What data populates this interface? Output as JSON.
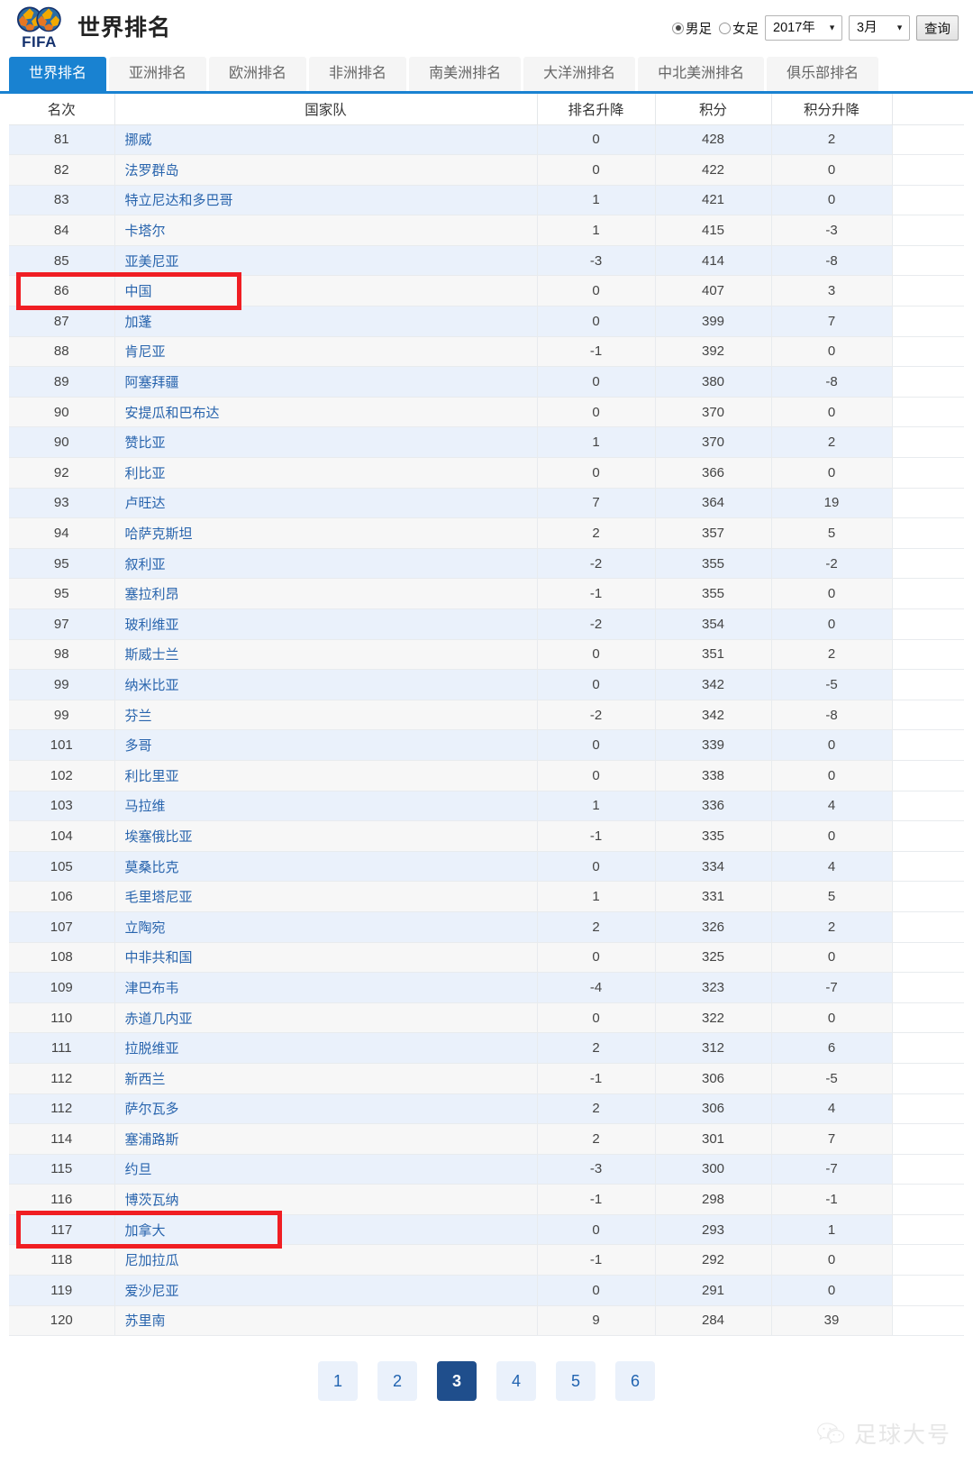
{
  "header": {
    "logo_alt": "FIFA",
    "title": "世界排名",
    "gender": {
      "male_label": "男足",
      "female_label": "女足",
      "selected": "男足"
    },
    "year_select": {
      "value": "2017年",
      "options": [
        "2017年"
      ]
    },
    "month_select": {
      "value": "3月",
      "options": [
        "3月"
      ]
    },
    "query_button": "查询"
  },
  "tabs": [
    {
      "label": "世界排名",
      "active": true
    },
    {
      "label": "亚洲排名",
      "active": false
    },
    {
      "label": "欧洲排名",
      "active": false
    },
    {
      "label": "非洲排名",
      "active": false
    },
    {
      "label": "南美洲排名",
      "active": false
    },
    {
      "label": "大洋洲排名",
      "active": false
    },
    {
      "label": "中北美洲排名",
      "active": false
    },
    {
      "label": "俱乐部排名",
      "active": false
    }
  ],
  "table": {
    "columns": [
      "名次",
      "国家队",
      "排名升降",
      "积分",
      "积分升降"
    ],
    "rows": [
      {
        "rank": "81",
        "country": "挪威",
        "delta": "0",
        "points": "428",
        "pts_delta": "2"
      },
      {
        "rank": "82",
        "country": "法罗群岛",
        "delta": "0",
        "points": "422",
        "pts_delta": "0"
      },
      {
        "rank": "83",
        "country": "特立尼达和多巴哥",
        "delta": "1",
        "points": "421",
        "pts_delta": "0"
      },
      {
        "rank": "84",
        "country": "卡塔尔",
        "delta": "1",
        "points": "415",
        "pts_delta": "-3"
      },
      {
        "rank": "85",
        "country": "亚美尼亚",
        "delta": "-3",
        "points": "414",
        "pts_delta": "-8"
      },
      {
        "rank": "86",
        "country": "中国",
        "delta": "0",
        "points": "407",
        "pts_delta": "3",
        "highlight": true
      },
      {
        "rank": "87",
        "country": "加蓬",
        "delta": "0",
        "points": "399",
        "pts_delta": "7"
      },
      {
        "rank": "88",
        "country": "肯尼亚",
        "delta": "-1",
        "points": "392",
        "pts_delta": "0"
      },
      {
        "rank": "89",
        "country": "阿塞拜疆",
        "delta": "0",
        "points": "380",
        "pts_delta": "-8"
      },
      {
        "rank": "90",
        "country": "安提瓜和巴布达",
        "delta": "0",
        "points": "370",
        "pts_delta": "0"
      },
      {
        "rank": "90",
        "country": "赞比亚",
        "delta": "1",
        "points": "370",
        "pts_delta": "2"
      },
      {
        "rank": "92",
        "country": "利比亚",
        "delta": "0",
        "points": "366",
        "pts_delta": "0"
      },
      {
        "rank": "93",
        "country": "卢旺达",
        "delta": "7",
        "points": "364",
        "pts_delta": "19"
      },
      {
        "rank": "94",
        "country": "哈萨克斯坦",
        "delta": "2",
        "points": "357",
        "pts_delta": "5"
      },
      {
        "rank": "95",
        "country": "叙利亚",
        "delta": "-2",
        "points": "355",
        "pts_delta": "-2"
      },
      {
        "rank": "95",
        "country": "塞拉利昂",
        "delta": "-1",
        "points": "355",
        "pts_delta": "0"
      },
      {
        "rank": "97",
        "country": "玻利维亚",
        "delta": "-2",
        "points": "354",
        "pts_delta": "0"
      },
      {
        "rank": "98",
        "country": "斯威士兰",
        "delta": "0",
        "points": "351",
        "pts_delta": "2"
      },
      {
        "rank": "99",
        "country": "纳米比亚",
        "delta": "0",
        "points": "342",
        "pts_delta": "-5"
      },
      {
        "rank": "99",
        "country": "芬兰",
        "delta": "-2",
        "points": "342",
        "pts_delta": "-8"
      },
      {
        "rank": "101",
        "country": "多哥",
        "delta": "0",
        "points": "339",
        "pts_delta": "0"
      },
      {
        "rank": "102",
        "country": "利比里亚",
        "delta": "0",
        "points": "338",
        "pts_delta": "0"
      },
      {
        "rank": "103",
        "country": "马拉维",
        "delta": "1",
        "points": "336",
        "pts_delta": "4"
      },
      {
        "rank": "104",
        "country": "埃塞俄比亚",
        "delta": "-1",
        "points": "335",
        "pts_delta": "0"
      },
      {
        "rank": "105",
        "country": "莫桑比克",
        "delta": "0",
        "points": "334",
        "pts_delta": "4"
      },
      {
        "rank": "106",
        "country": "毛里塔尼亚",
        "delta": "1",
        "points": "331",
        "pts_delta": "5"
      },
      {
        "rank": "107",
        "country": "立陶宛",
        "delta": "2",
        "points": "326",
        "pts_delta": "2"
      },
      {
        "rank": "108",
        "country": "中非共和国",
        "delta": "0",
        "points": "325",
        "pts_delta": "0"
      },
      {
        "rank": "109",
        "country": "津巴布韦",
        "delta": "-4",
        "points": "323",
        "pts_delta": "-7"
      },
      {
        "rank": "110",
        "country": "赤道几内亚",
        "delta": "0",
        "points": "322",
        "pts_delta": "0"
      },
      {
        "rank": "111",
        "country": "拉脱维亚",
        "delta": "2",
        "points": "312",
        "pts_delta": "6"
      },
      {
        "rank": "112",
        "country": "新西兰",
        "delta": "-1",
        "points": "306",
        "pts_delta": "-5"
      },
      {
        "rank": "112",
        "country": "萨尔瓦多",
        "delta": "2",
        "points": "306",
        "pts_delta": "4"
      },
      {
        "rank": "114",
        "country": "塞浦路斯",
        "delta": "2",
        "points": "301",
        "pts_delta": "7"
      },
      {
        "rank": "115",
        "country": "约旦",
        "delta": "-3",
        "points": "300",
        "pts_delta": "-7"
      },
      {
        "rank": "116",
        "country": "博茨瓦纳",
        "delta": "-1",
        "points": "298",
        "pts_delta": "-1"
      },
      {
        "rank": "117",
        "country": "加拿大",
        "delta": "0",
        "points": "293",
        "pts_delta": "1",
        "highlight": true,
        "highlight_wide": true
      },
      {
        "rank": "118",
        "country": "尼加拉瓜",
        "delta": "-1",
        "points": "292",
        "pts_delta": "0"
      },
      {
        "rank": "119",
        "country": "爱沙尼亚",
        "delta": "0",
        "points": "291",
        "pts_delta": "0"
      },
      {
        "rank": "120",
        "country": "苏里南",
        "delta": "9",
        "points": "284",
        "pts_delta": "39"
      }
    ]
  },
  "pagination": {
    "pages": [
      "1",
      "2",
      "3",
      "4",
      "5",
      "6"
    ],
    "current": "3"
  },
  "watermark": {
    "text": "足球大号",
    "icon": "wechat-icon"
  },
  "colors": {
    "accent": "#1982d1",
    "up": "#e8322a",
    "down": "#1d9d27",
    "link": "#2864ad",
    "highlight_box": "#f01e23",
    "pager_active": "#1f4e8c"
  }
}
